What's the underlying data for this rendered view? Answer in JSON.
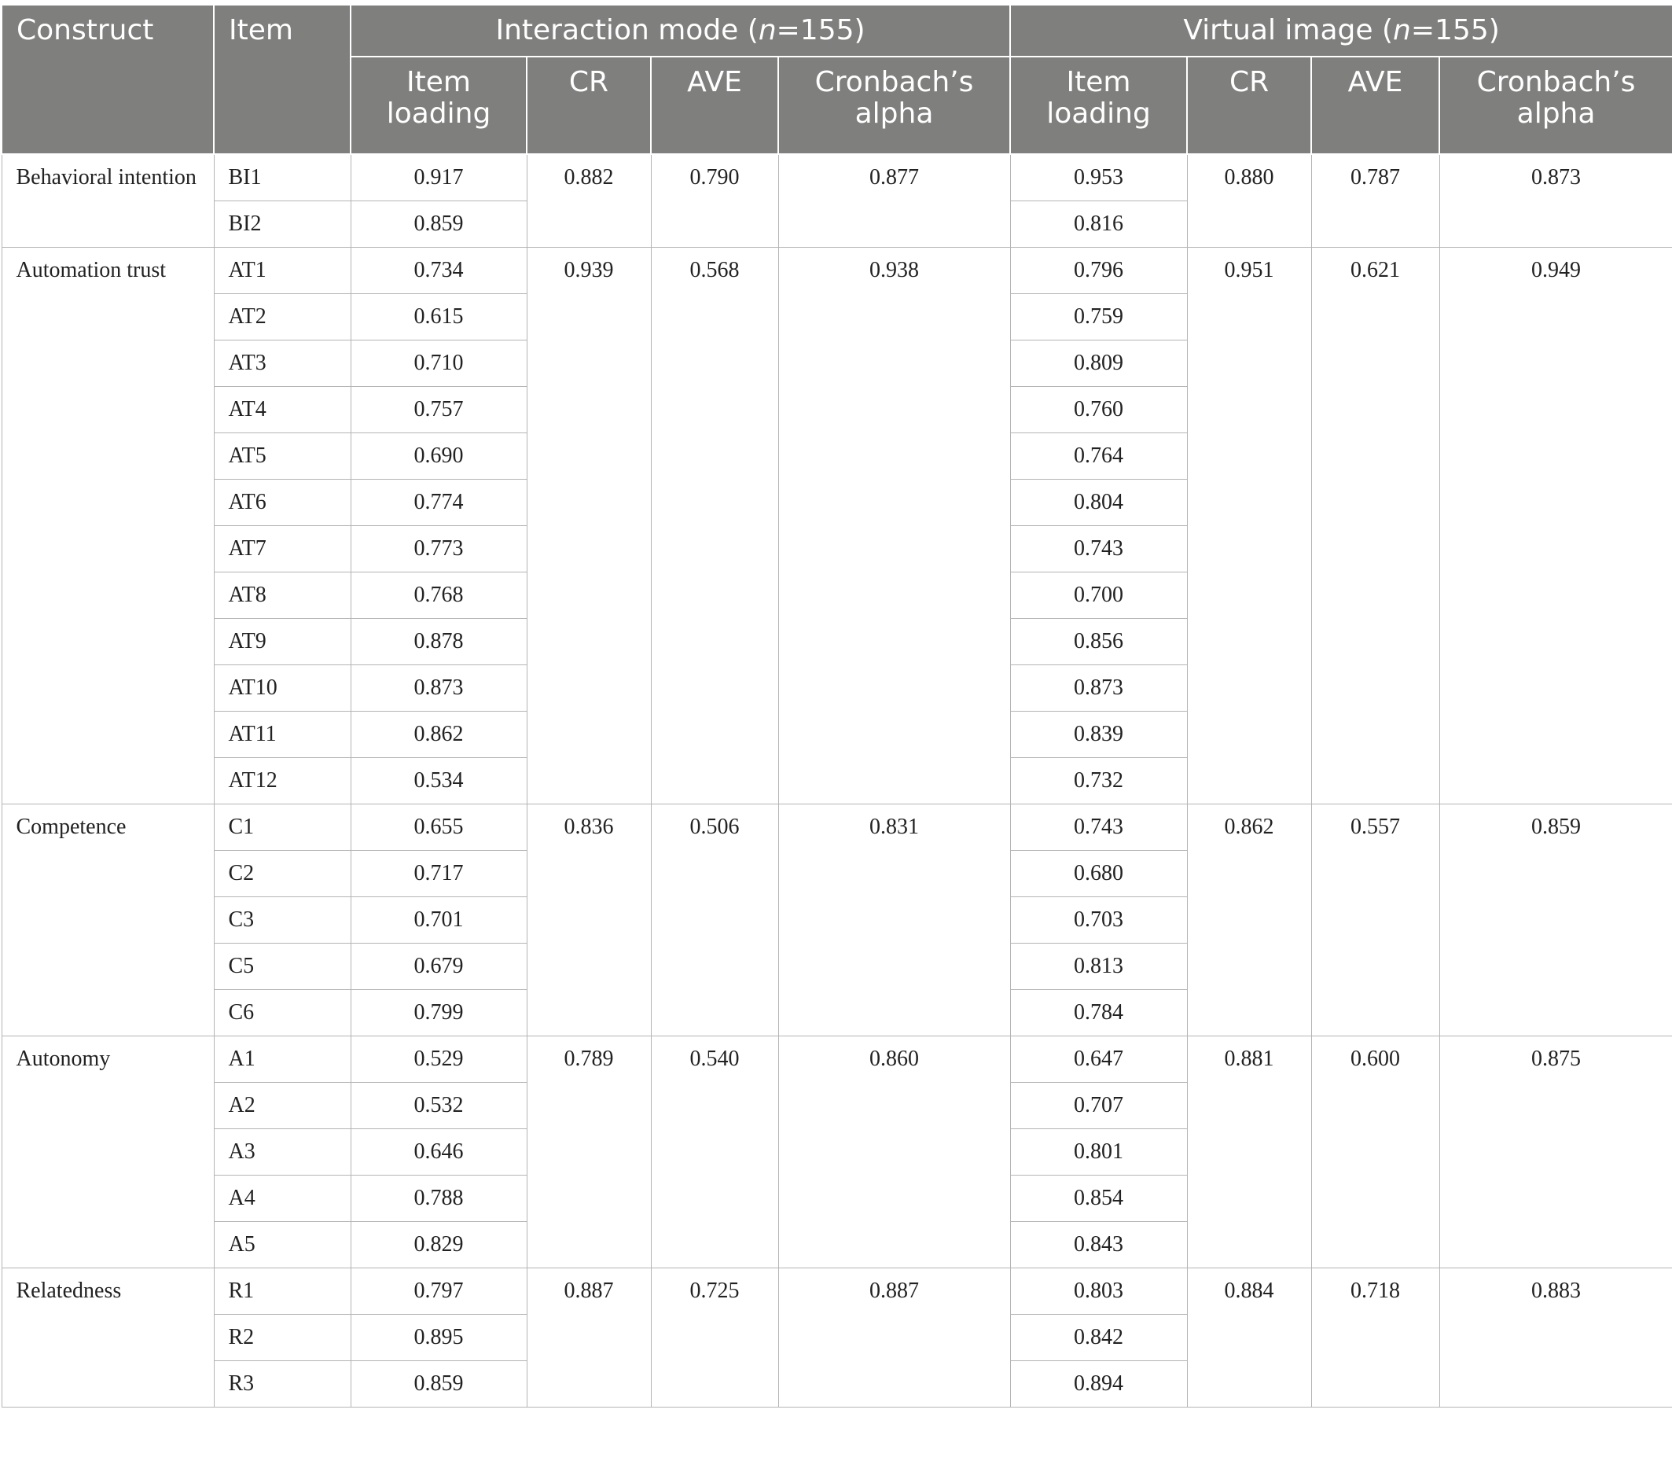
{
  "headers": {
    "construct": "Construct",
    "item": "Item",
    "group1_prefix": "Interaction mode (",
    "group1_n": "n",
    "group1_suffix": "=155)",
    "group2_prefix": "Virtual image (",
    "group2_n": "n",
    "group2_suffix": "=155)",
    "sub": {
      "item_loading_1": "Item",
      "item_loading_2": "loading",
      "cr": "CR",
      "ave": "AVE",
      "alpha_1": "Cronbach’s",
      "alpha_2": "alpha"
    }
  },
  "groups": [
    {
      "construct": "Behavioral intention",
      "im": {
        "cr": "0.882",
        "ave": "0.790",
        "alpha": "0.877"
      },
      "vi": {
        "cr": "0.880",
        "ave": "0.787",
        "alpha": "0.873"
      },
      "items": [
        {
          "item": "BI1",
          "im": "0.917",
          "vi": "0.953"
        },
        {
          "item": "BI2",
          "im": "0.859",
          "vi": "0.816"
        }
      ]
    },
    {
      "construct": "Automation trust",
      "im": {
        "cr": "0.939",
        "ave": "0.568",
        "alpha": "0.938"
      },
      "vi": {
        "cr": "0.951",
        "ave": "0.621",
        "alpha": "0.949"
      },
      "items": [
        {
          "item": "AT1",
          "im": "0.734",
          "vi": "0.796"
        },
        {
          "item": "AT2",
          "im": "0.615",
          "vi": "0.759"
        },
        {
          "item": "AT3",
          "im": "0.710",
          "vi": "0.809"
        },
        {
          "item": "AT4",
          "im": "0.757",
          "vi": "0.760"
        },
        {
          "item": "AT5",
          "im": "0.690",
          "vi": "0.764"
        },
        {
          "item": "AT6",
          "im": "0.774",
          "vi": "0.804"
        },
        {
          "item": "AT7",
          "im": "0.773",
          "vi": "0.743"
        },
        {
          "item": "AT8",
          "im": "0.768",
          "vi": "0.700"
        },
        {
          "item": "AT9",
          "im": "0.878",
          "vi": "0.856"
        },
        {
          "item": "AT10",
          "im": "0.873",
          "vi": "0.873"
        },
        {
          "item": "AT11",
          "im": "0.862",
          "vi": "0.839"
        },
        {
          "item": "AT12",
          "im": "0.534",
          "vi": "0.732"
        }
      ]
    },
    {
      "construct": "Competence",
      "im": {
        "cr": "0.836",
        "ave": "0.506",
        "alpha": "0.831"
      },
      "vi": {
        "cr": "0.862",
        "ave": "0.557",
        "alpha": "0.859"
      },
      "items": [
        {
          "item": "C1",
          "im": "0.655",
          "vi": "0.743"
        },
        {
          "item": "C2",
          "im": "0.717",
          "vi": "0.680"
        },
        {
          "item": "C3",
          "im": "0.701",
          "vi": "0.703"
        },
        {
          "item": "C5",
          "im": "0.679",
          "vi": "0.813"
        },
        {
          "item": "C6",
          "im": "0.799",
          "vi": "0.784"
        }
      ]
    },
    {
      "construct": "Autonomy",
      "im": {
        "cr": "0.789",
        "ave": "0.540",
        "alpha": "0.860"
      },
      "vi": {
        "cr": "0.881",
        "ave": "0.600",
        "alpha": "0.875"
      },
      "items": [
        {
          "item": "A1",
          "im": "0.529",
          "vi": "0.647"
        },
        {
          "item": "A2",
          "im": "0.532",
          "vi": "0.707"
        },
        {
          "item": "A3",
          "im": "0.646",
          "vi": "0.801"
        },
        {
          "item": "A4",
          "im": "0.788",
          "vi": "0.854"
        },
        {
          "item": "A5",
          "im": "0.829",
          "vi": "0.843"
        }
      ]
    },
    {
      "construct": "Relatedness",
      "im": {
        "cr": "0.887",
        "ave": "0.725",
        "alpha": "0.887"
      },
      "vi": {
        "cr": "0.884",
        "ave": "0.718",
        "alpha": "0.883"
      },
      "items": [
        {
          "item": "R1",
          "im": "0.797",
          "vi": "0.803"
        },
        {
          "item": "R2",
          "im": "0.895",
          "vi": "0.842"
        },
        {
          "item": "R3",
          "im": "0.859",
          "vi": "0.894"
        }
      ]
    }
  ]
}
